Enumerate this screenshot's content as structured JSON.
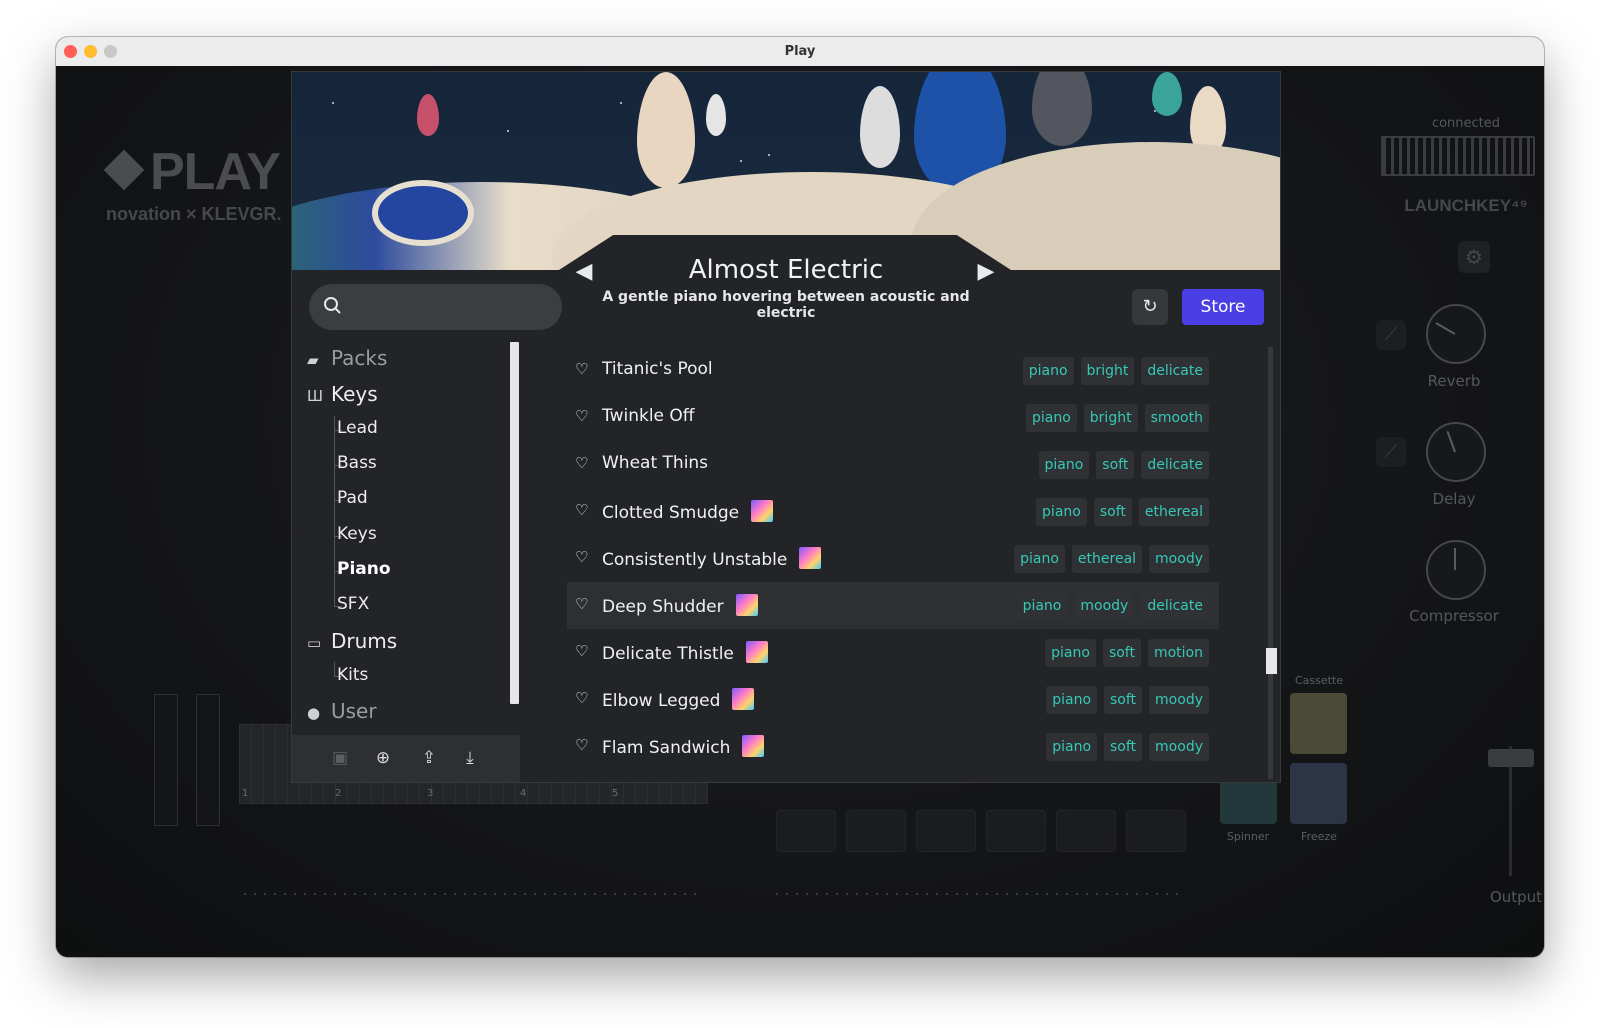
{
  "window": {
    "title": "Play"
  },
  "brand": {
    "logo": "PLAY",
    "sub": "novation × KLEVGR."
  },
  "device": {
    "status": "connected",
    "name": "LAUNCHKEY⁴⁹",
    "gear_icon": "gear-icon"
  },
  "banner": {
    "preset_title": "Almost Electric",
    "preset_description": "A gentle piano hovering between acoustic and electric"
  },
  "search": {
    "placeholder": "",
    "value": ""
  },
  "toolbar": {
    "store_label": "Store"
  },
  "categories": {
    "packs": "Packs",
    "keys": "Keys",
    "keys_children": [
      "Lead",
      "Bass",
      "Pad",
      "Keys",
      "Piano",
      "SFX"
    ],
    "drums": "Drums",
    "drums_children": [
      "Kits"
    ],
    "user": "User",
    "selected": "Piano"
  },
  "presets": [
    {
      "name": "Titanic's Pool",
      "art": false,
      "tags": [
        "piano",
        "bright",
        "delicate"
      ]
    },
    {
      "name": "Twinkle Off",
      "art": false,
      "tags": [
        "piano",
        "bright",
        "smooth"
      ]
    },
    {
      "name": "Wheat Thins",
      "art": false,
      "tags": [
        "piano",
        "soft",
        "delicate"
      ]
    },
    {
      "name": "Clotted Smudge",
      "art": true,
      "tags": [
        "piano",
        "soft",
        "ethereal"
      ]
    },
    {
      "name": "Consistently Unstable",
      "art": true,
      "tags": [
        "piano",
        "ethereal",
        "moody"
      ]
    },
    {
      "name": "Deep Shudder",
      "art": true,
      "tags": [
        "piano",
        "moody",
        "delicate"
      ],
      "highlighted": true
    },
    {
      "name": "Delicate Thistle",
      "art": true,
      "tags": [
        "piano",
        "soft",
        "motion"
      ]
    },
    {
      "name": "Elbow Legged",
      "art": true,
      "tags": [
        "piano",
        "soft",
        "moody"
      ]
    },
    {
      "name": "Flam Sandwich",
      "art": true,
      "tags": [
        "piano",
        "soft",
        "moody"
      ]
    }
  ],
  "effects": {
    "reverb": "Reverb",
    "delay": "Delay",
    "compressor": "Compressor",
    "output": "Output"
  },
  "pads": {
    "cassette": "Cassette",
    "spinner": "Spinner",
    "freeze": "Freeze"
  },
  "keyboard_octaves": [
    "1",
    "2",
    "3",
    "4",
    "5"
  ],
  "colors": {
    "accent": "#4a3fe4",
    "tag_text": "#36c9b6"
  }
}
